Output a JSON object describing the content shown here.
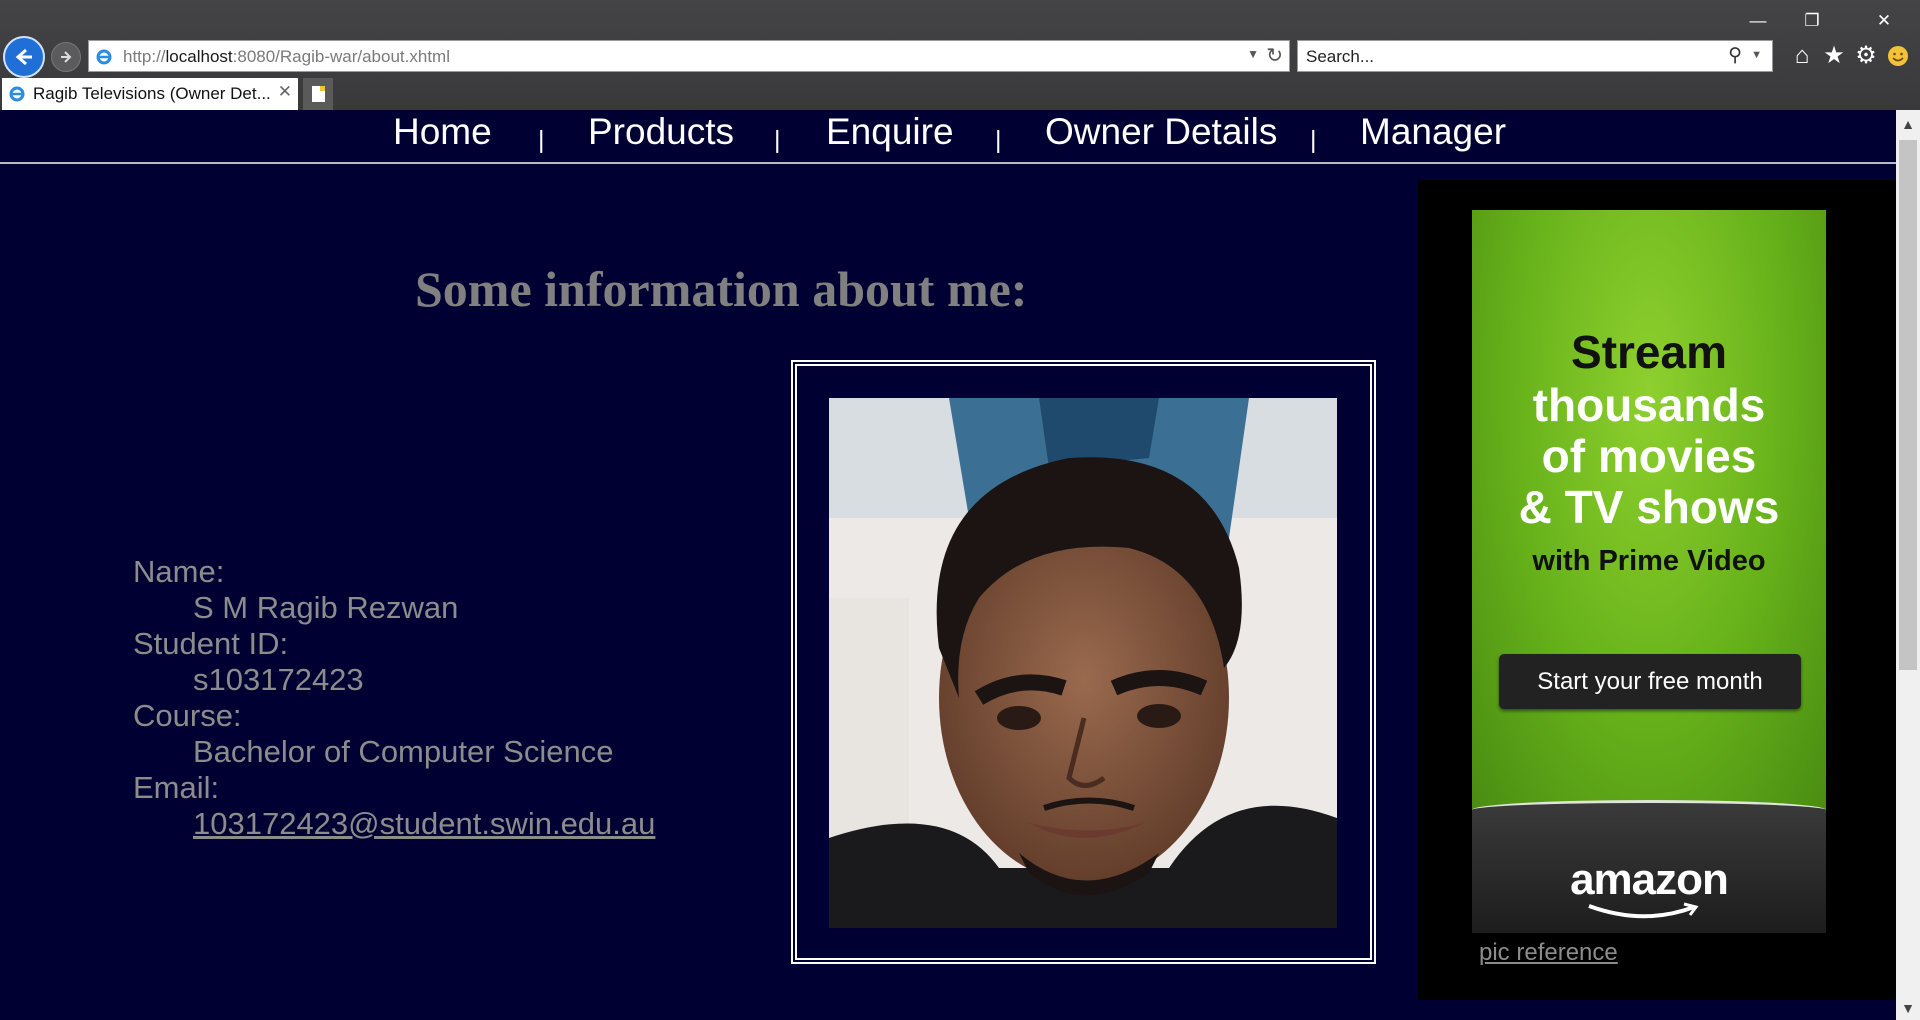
{
  "browser": {
    "url_prefix": "http://",
    "url_host": "localhost",
    "url_rest": ":8080/Ragib-war/about.xhtml",
    "search_placeholder": "Search...",
    "tab_title": "Ragib Televisions (Owner Det...",
    "window_controls": [
      "minimize-icon",
      "restore-icon",
      "close-icon"
    ],
    "toolbar_icons": [
      "home-icon",
      "favorites-star-icon",
      "settings-gear-icon",
      "smiley-feedback-icon"
    ]
  },
  "nav": {
    "items": [
      "Home",
      "Products",
      "Enquire",
      "Owner Details",
      "Manager"
    ],
    "separator": "|"
  },
  "main": {
    "heading": "Some information about me:",
    "name_label": "Name:",
    "name_value": "S M Ragib Rezwan",
    "id_label": "Student ID:",
    "id_value": "s103172423",
    "course_label": "Course:",
    "course_value": "Bachelor of Computer Science",
    "email_label": "Email:",
    "email_value": "103172423@student.swin.edu.au"
  },
  "ad": {
    "line1": "Stream",
    "line2": "thousands",
    "line3": "of movies",
    "line4": "& TV shows",
    "line5": "with Prime Video",
    "button": "Start your free month",
    "logo": "amazon",
    "colors": {
      "green": "#66b11a",
      "dark": "#222222"
    }
  },
  "pic_reference": "pic reference",
  "colors": {
    "page_bg": "#000033",
    "text_gray": "#8c8c8c",
    "nav_text": "#ffffff"
  }
}
